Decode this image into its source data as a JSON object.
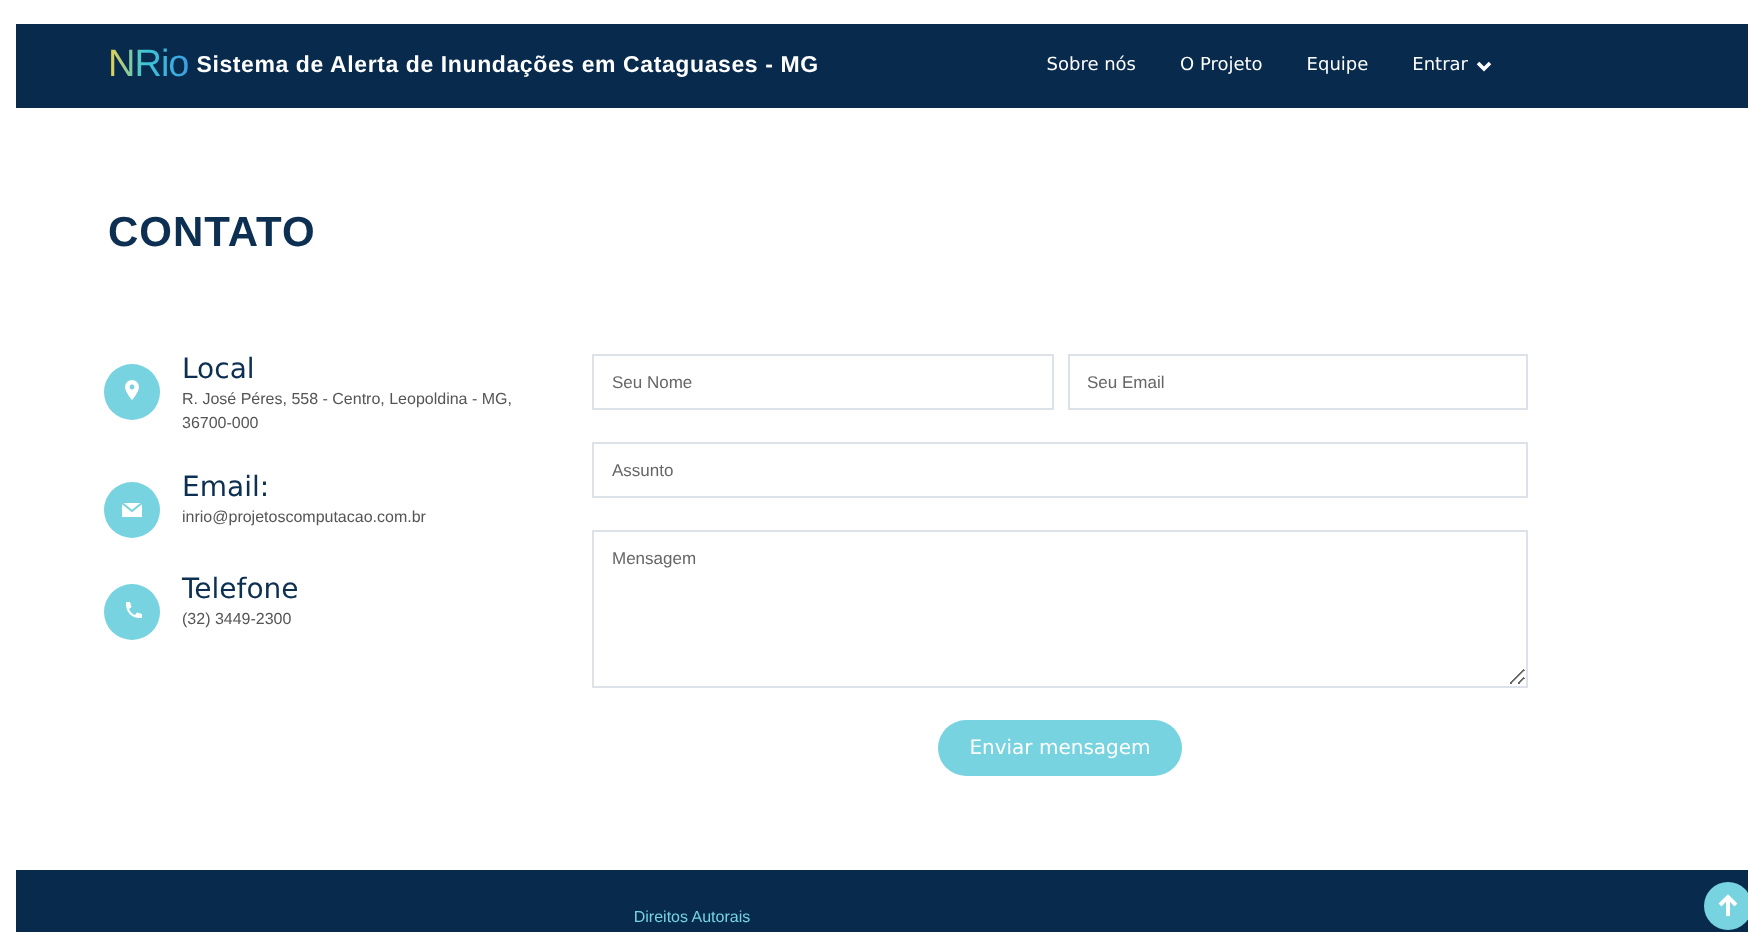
{
  "header": {
    "logo": "NRio",
    "title": "Sistema de Alerta de Inundações em Cataguases - MG",
    "nav": [
      {
        "label": "Sobre nós",
        "kind": "link"
      },
      {
        "label": "O Projeto",
        "kind": "link"
      },
      {
        "label": "Equipe",
        "kind": "link"
      },
      {
        "label": "Entrar",
        "kind": "dropdown"
      }
    ]
  },
  "heading": "CONTATO",
  "contacts": [
    {
      "kind": "location",
      "title": "Local",
      "lines": [
        "R. José Péres, 558 - Centro, Leopoldina - MG,",
        "36700-000"
      ]
    },
    {
      "kind": "email",
      "title": "Email:",
      "lines": [
        "inrio@projetoscomputacao.com.br"
      ]
    },
    {
      "kind": "phone",
      "title": "Telefone",
      "lines": [
        "(32) 3449-2300"
      ]
    }
  ],
  "form": {
    "name": {
      "placeholder": "Seu Nome"
    },
    "email": {
      "placeholder": "Seu Email"
    },
    "subject": {
      "placeholder": "Assunto"
    },
    "message": {
      "placeholder": "Mensagem"
    },
    "submit": "Enviar mensagem"
  },
  "footer": {
    "text": "Direitos Autorais"
  }
}
